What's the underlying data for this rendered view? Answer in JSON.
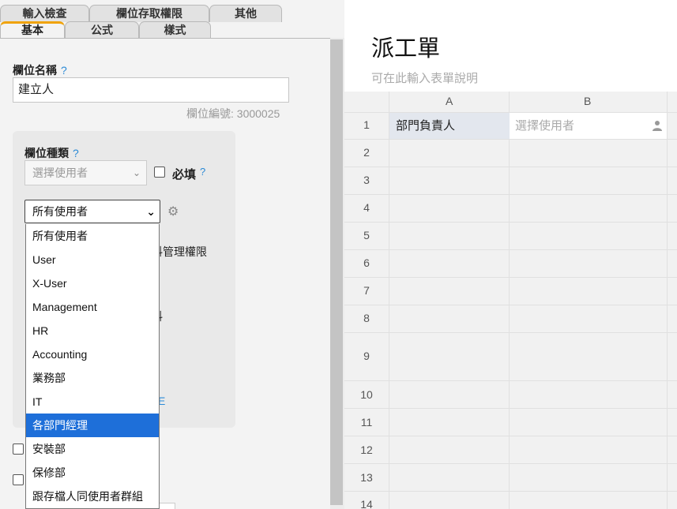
{
  "tabs": {
    "row1": [
      "輸入檢查",
      "欄位存取權限",
      "其他"
    ],
    "row2": [
      "基本",
      "公式",
      "樣式"
    ]
  },
  "field": {
    "name_label": "欄位名稱",
    "help": "?",
    "name_value": "建立人",
    "id_hint": "欄位編號: 3000025"
  },
  "type": {
    "label": "欄位種類",
    "selected": "選擇使用者",
    "required_label": "必填"
  },
  "group_select": {
    "value": "所有使用者",
    "options": [
      "所有使用者",
      "User",
      "X-User",
      "Management",
      "HR",
      "Accounting",
      "業務部",
      "IT",
      "各部門經理",
      "安裝部",
      "保修部",
      "跟存檔人同使用者群組"
    ],
    "highlighted_index": 8
  },
  "behind_text": {
    "perm": "料管理權限",
    "data": "料",
    "link": "E"
  },
  "form": {
    "title": "派工單",
    "desc": "可在此輸入表單說明"
  },
  "sheet": {
    "columns": [
      "A",
      "B"
    ],
    "rows": [
      "1",
      "2",
      "3",
      "4",
      "5",
      "6",
      "7",
      "8",
      "9",
      "10",
      "11",
      "12",
      "13",
      "14"
    ],
    "a1": "部門負責人",
    "b1_placeholder": "選擇使用者"
  },
  "colors": {
    "accent_tab": "#f0a30a",
    "selection": "#1e6fd9",
    "help": "#2b8ad6"
  }
}
